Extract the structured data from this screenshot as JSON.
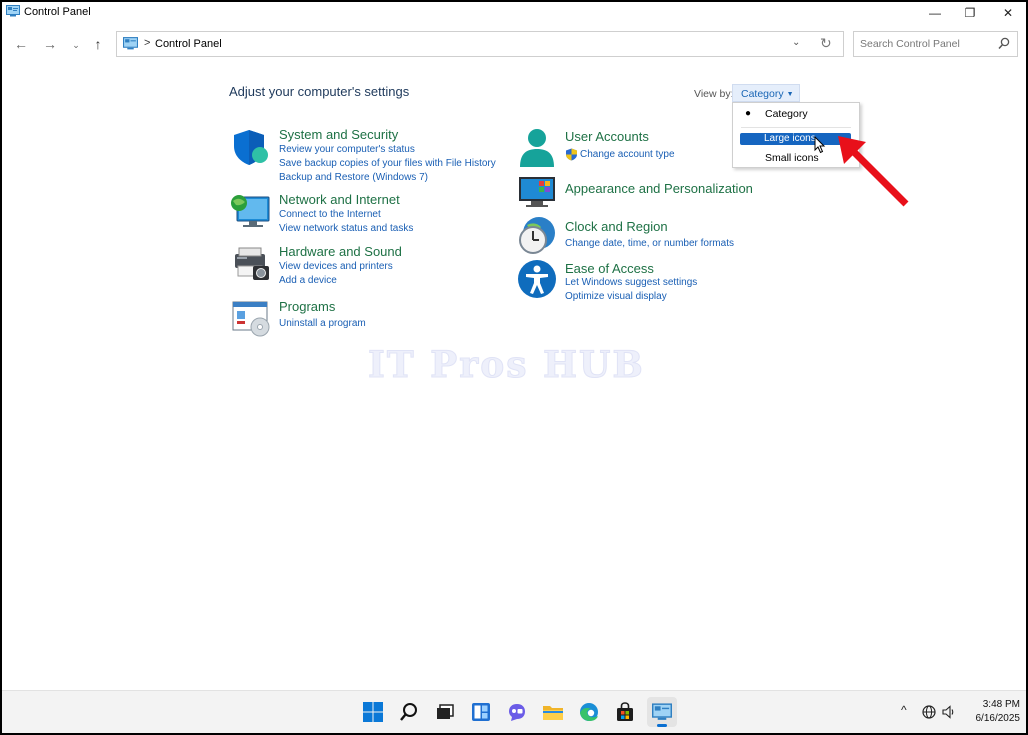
{
  "window": {
    "title": "Control Panel",
    "minimize": "—",
    "maximize": "❐",
    "close": "✕"
  },
  "nav": {
    "back": "←",
    "forward": "→",
    "recent": "⌄",
    "up": "↑",
    "address_sep": ">",
    "breadcrumb": "Control Panel",
    "address_dropdown": "⌄",
    "refresh": "↻",
    "search_placeholder": "Search Control Panel"
  },
  "content": {
    "heading": "Adjust your computer's settings",
    "view_by_label": "View by:",
    "view_by_value": "Category",
    "view_by_caret": "▼",
    "watermark": "IT Pros HUB"
  },
  "categories_left": [
    {
      "title": "System and Security",
      "links": [
        "Review your computer's status",
        "Save backup copies of your files with File History",
        "Backup and Restore (Windows 7)"
      ]
    },
    {
      "title": "Network and Internet",
      "links": [
        "Connect to the Internet",
        "View network status and tasks"
      ]
    },
    {
      "title": "Hardware and Sound",
      "links": [
        "View devices and printers",
        "Add a device"
      ]
    },
    {
      "title": "Programs",
      "links": [
        "Uninstall a program"
      ]
    }
  ],
  "categories_right": [
    {
      "title": "User Accounts",
      "links": [
        "Change account type"
      ]
    },
    {
      "title": "Appearance and Personalization",
      "links": []
    },
    {
      "title": "Clock and Region",
      "links": [
        "Change date, time, or number formats"
      ]
    },
    {
      "title": "Ease of Access",
      "links": [
        "Let Windows suggest settings",
        "Optimize visual display"
      ]
    }
  ],
  "view_menu": {
    "items": [
      "Category",
      "Large icons",
      "Small icons"
    ],
    "selected": "Category",
    "highlighted": "Large icons",
    "bullet": "●"
  },
  "colors": {
    "category_title": "#1e7145",
    "link": "#1a5fb4",
    "highlight": "#1565c0",
    "annotation_arrow": "#e8101a"
  },
  "taskbar": {
    "tray_chevron": "^",
    "time": "3:48 PM",
    "date": "6/16/2025"
  }
}
